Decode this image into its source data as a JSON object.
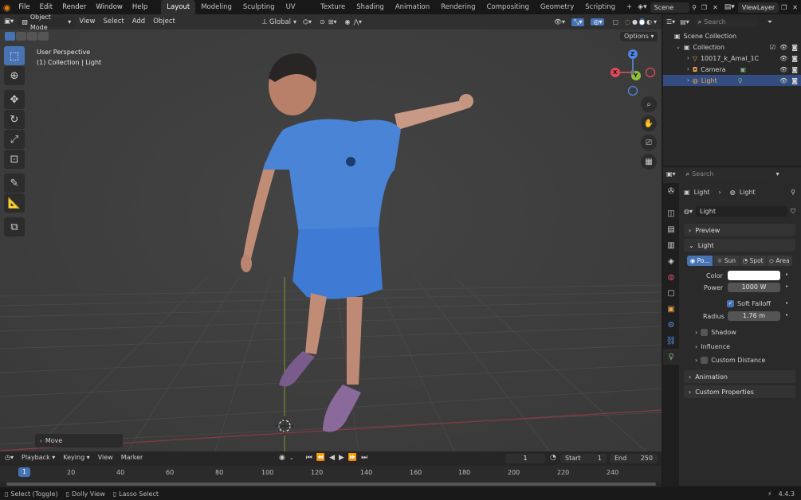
{
  "topbar": {
    "menus": [
      "File",
      "Edit",
      "Render",
      "Window",
      "Help"
    ],
    "workspaces": [
      "Layout",
      "Modeling",
      "Sculpting",
      "UV Editing",
      "Texture Paint",
      "Shading",
      "Animation",
      "Rendering",
      "Compositing",
      "Geometry Nodes",
      "Scripting"
    ],
    "active_workspace": "Layout",
    "add_tab": "+",
    "scene": "Scene",
    "view_layer": "ViewLayer"
  },
  "viewport": {
    "mode": "Object Mode",
    "menus": [
      "View",
      "Select",
      "Add",
      "Object"
    ],
    "transform": "Global",
    "options": "Options",
    "perspective": "User Perspective",
    "collection_info": "(1) Collection | Light",
    "operator_panel": "Move",
    "gizmo": {
      "z": "Z",
      "x": "X",
      "y": "Y"
    }
  },
  "outliner": {
    "search_placeholder": "Search",
    "items": [
      {
        "label": "Scene Collection"
      },
      {
        "label": "Collection"
      },
      {
        "label": "10017_k_Amal_1C"
      },
      {
        "label": "Camera"
      },
      {
        "label": "Light"
      }
    ]
  },
  "properties": {
    "search_placeholder": "Search",
    "breadcrumb": [
      "Light",
      "Light"
    ],
    "datablock": "Light",
    "panels": {
      "preview": "Preview",
      "light": "Light"
    },
    "light_types": [
      "Po...",
      "Sun",
      "Spot",
      "Area"
    ],
    "color_label": "Color",
    "power_label": "Power",
    "power_value": "1000 W",
    "soft_falloff_label": "Soft Falloff",
    "radius_label": "Radius",
    "radius_value": "1.76 m",
    "subpanels": {
      "shadow": "Shadow",
      "influence": "Influence",
      "custom_distance": "Custom Distance"
    },
    "animation": "Animation",
    "custom_properties": "Custom Properties",
    "color_value": "#ffffff"
  },
  "timeline": {
    "menus": [
      "Playback",
      "Keying",
      "View",
      "Marker"
    ],
    "current_frame": "1",
    "start_label": "Start",
    "start_value": "1",
    "end_label": "End",
    "end_value": "250",
    "ticks": [
      "1",
      "20",
      "40",
      "60",
      "80",
      "100",
      "120",
      "140",
      "160",
      "180",
      "200",
      "220",
      "240"
    ]
  },
  "statusbar": {
    "items": [
      "Select (Toggle)",
      "Dolly View",
      "Lasso Select"
    ],
    "version": "4.4.3"
  },
  "colors": {
    "accent": "#4772b3",
    "selected_row": "#334d80",
    "blender_orange": "#e87d0d",
    "frame_marker": "#4772b3"
  }
}
